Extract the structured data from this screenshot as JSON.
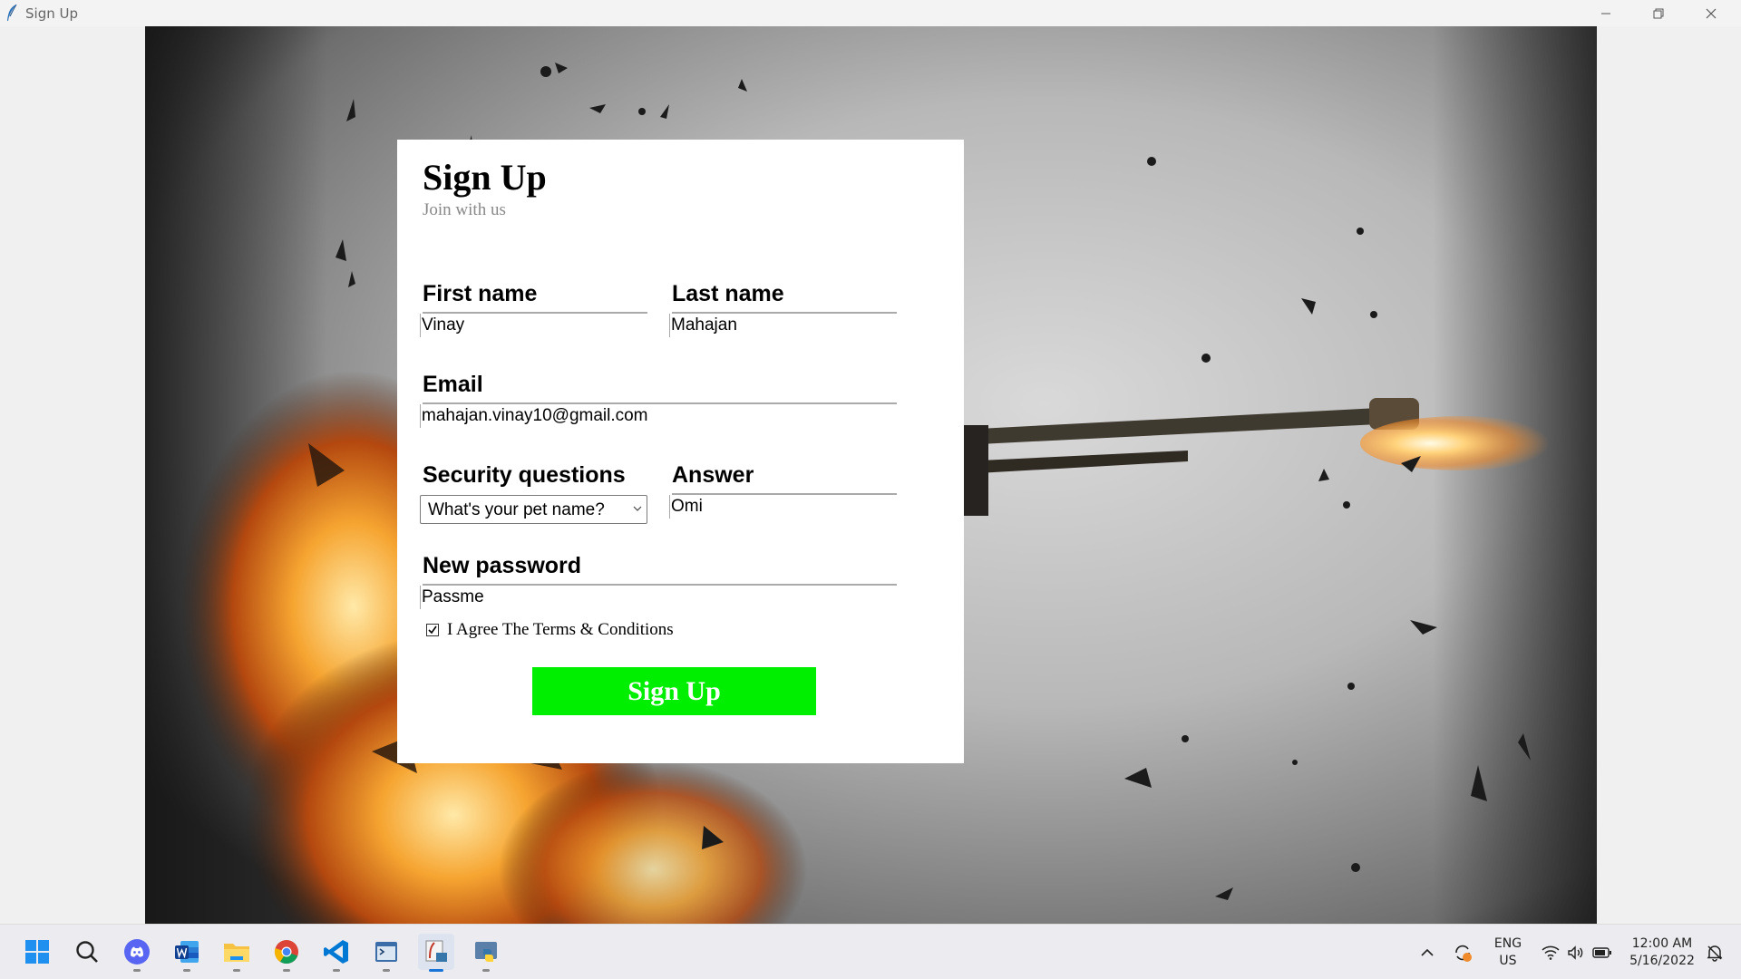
{
  "window": {
    "title": "Sign Up",
    "icon": "feather-icon",
    "controls": [
      "minimize-icon",
      "restore-icon",
      "close-icon"
    ]
  },
  "form": {
    "title": "Sign Up",
    "subtitle": "Join with us",
    "first_name": {
      "label": "First name",
      "value": "Vinay"
    },
    "last_name": {
      "label": "Last name",
      "value": "Mahajan"
    },
    "email": {
      "label": "Email",
      "value": "mahajan.vinay10@gmail.com"
    },
    "security_question": {
      "label": "Security questions",
      "selected": "What's your pet name?"
    },
    "answer": {
      "label": "Answer",
      "value": "Omi"
    },
    "new_password": {
      "label": "New password",
      "value": "Passme"
    },
    "terms": {
      "label": "I Agree The Terms & Conditions",
      "checked": true
    },
    "submit_label": "Sign Up"
  },
  "taskbar": {
    "apps": [
      "windows-start-icon",
      "search-icon",
      "discord-icon",
      "word-icon",
      "file-explorer-icon",
      "chrome-icon",
      "vscode-icon",
      "python-idle-icon",
      "tkinter-app-icon",
      "python-icon"
    ],
    "tray": {
      "language": "ENG",
      "region": "US",
      "time": "12:00 AM",
      "date": "5/16/2022"
    }
  },
  "colors": {
    "submit_button": "#00ef00",
    "card_background": "#ffffff"
  }
}
